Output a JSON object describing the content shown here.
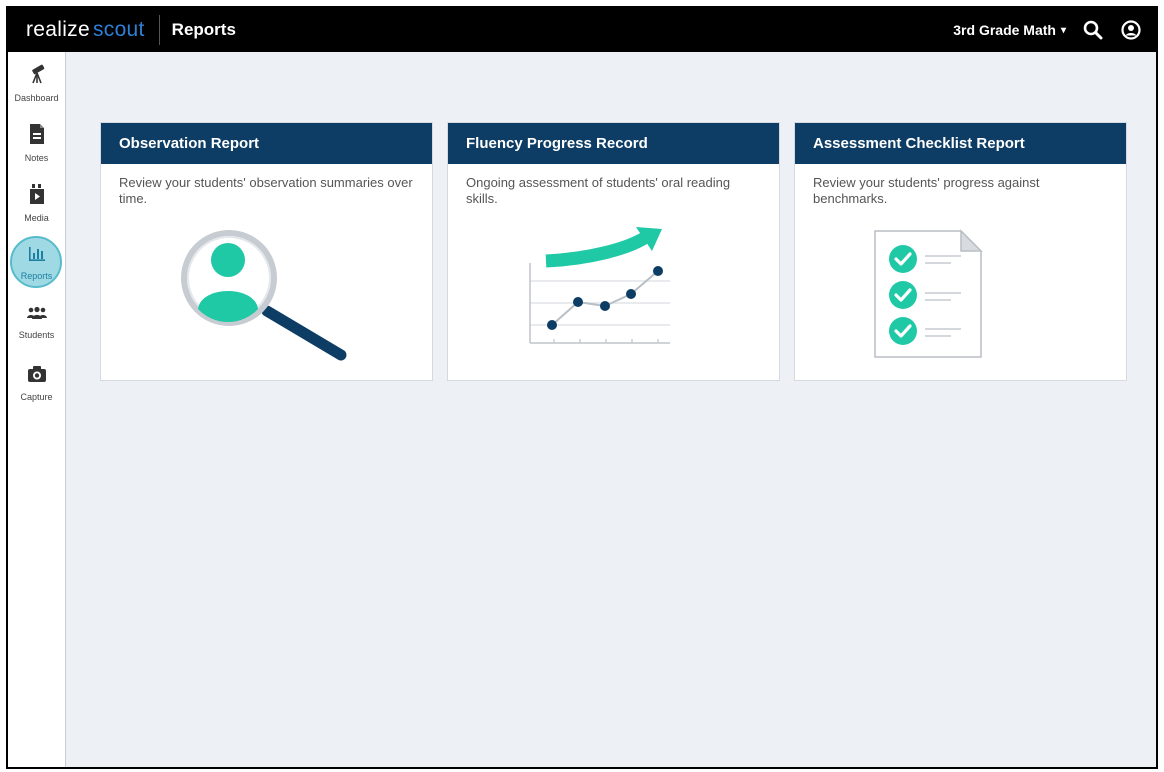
{
  "header": {
    "logo_realize": "realize",
    "logo_scout": "scout",
    "page_title": "Reports",
    "course_selector": "3rd Grade Math",
    "icons": [
      "search-icon",
      "account-icon"
    ]
  },
  "sidebar": {
    "items": [
      {
        "label": "Dashboard",
        "icon": "telescope-icon",
        "active": false
      },
      {
        "label": "Notes",
        "icon": "note-icon",
        "active": false
      },
      {
        "label": "Media",
        "icon": "media-icon",
        "active": false
      },
      {
        "label": "Reports",
        "icon": "bar-chart-icon",
        "active": true
      },
      {
        "label": "Students",
        "icon": "students-icon",
        "active": false
      },
      {
        "label": "Capture",
        "icon": "camera-icon",
        "active": false
      }
    ]
  },
  "cards": [
    {
      "title": "Observation Report",
      "description": "Review your students' observation summaries over time.",
      "illustration": "magnifier-person"
    },
    {
      "title": "Fluency Progress Record",
      "description": "Ongoing assessment of students' oral reading skills.",
      "illustration": "trend-line-chart"
    },
    {
      "title": "Assessment Checklist Report",
      "description": "Review your students' progress against benchmarks.",
      "illustration": "checklist-document"
    }
  ],
  "colors": {
    "topbar": "#000000",
    "card_header": "#0d3d64",
    "teal_accent": "#20c9a6",
    "page_bg": "#edf1f6",
    "logo_scout": "#2f7fd6"
  }
}
